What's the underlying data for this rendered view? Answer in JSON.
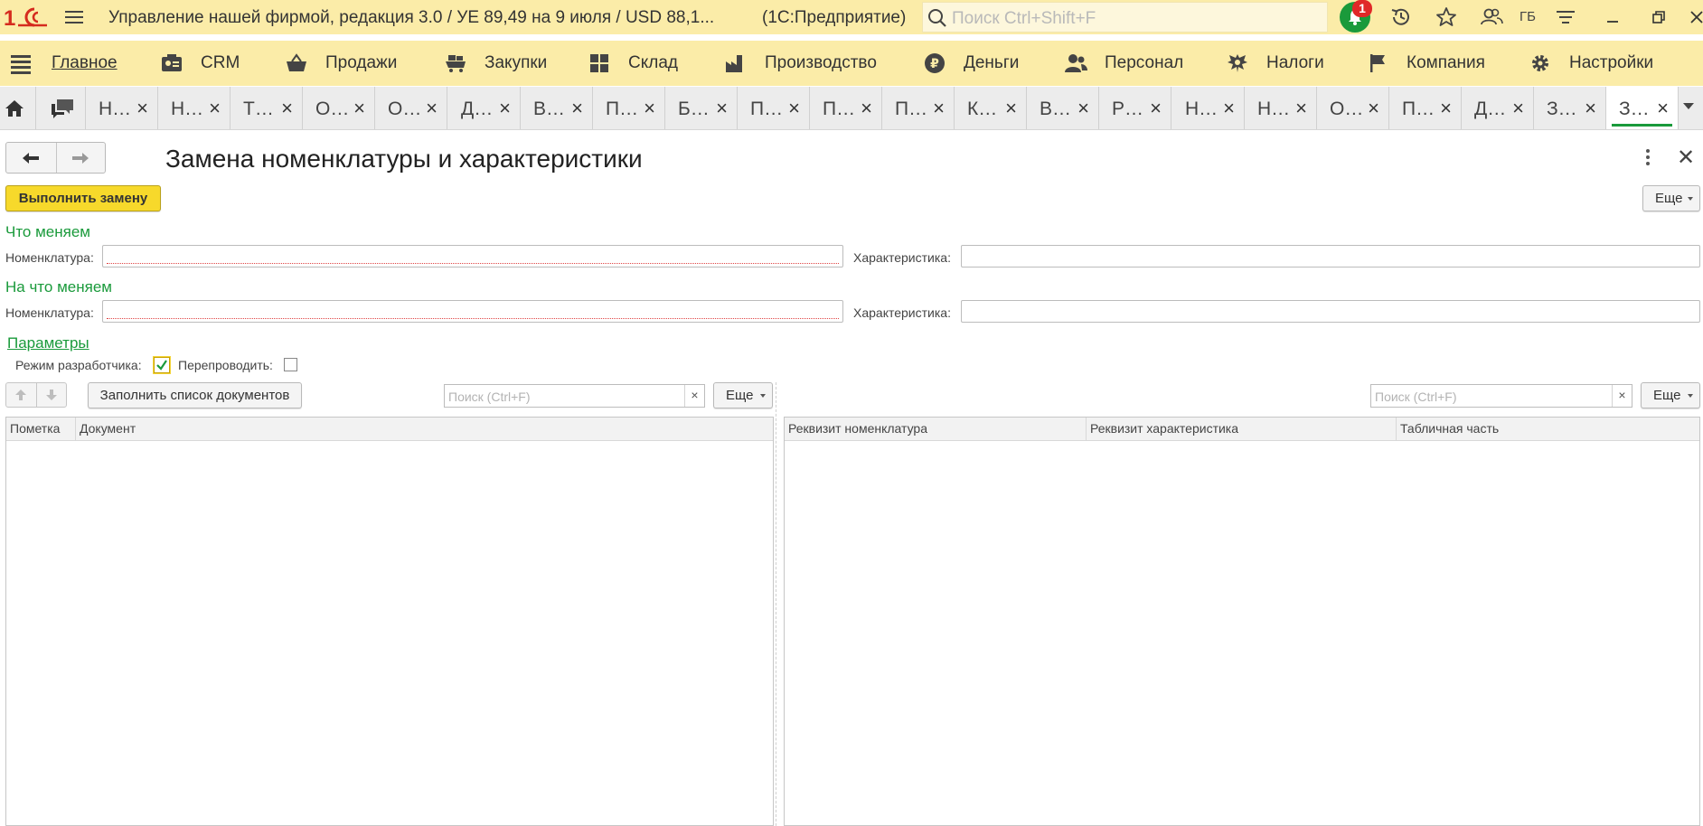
{
  "app": {
    "title": "Управление нашей фирмой, редакция 3.0 / УЕ 89,49 на 9 июля / USD 88,1...",
    "platform": "(1С:Предприятие)",
    "search_placeholder": "Поиск Ctrl+Shift+F",
    "notification_count": "1",
    "user_initials": "ГБ",
    "accent_color": "#1a9a3b",
    "panel_color": "#fbeca8"
  },
  "sections": [
    {
      "label": "Главное",
      "icon": "list-icon"
    },
    {
      "label": "CRM",
      "icon": "contact-card-icon"
    },
    {
      "label": "Продажи",
      "icon": "basket-icon"
    },
    {
      "label": "Закупки",
      "icon": "cart-icon"
    },
    {
      "label": "Склад",
      "icon": "warehouse-grid-icon"
    },
    {
      "label": "Производство",
      "icon": "factory-icon"
    },
    {
      "label": "Деньги",
      "icon": "ruble-coin-icon"
    },
    {
      "label": "Персонал",
      "icon": "people-icon"
    },
    {
      "label": "Налоги",
      "icon": "eagle-emblem-icon"
    },
    {
      "label": "Компания",
      "icon": "flag-icon"
    },
    {
      "label": "Настройки",
      "icon": "gear-icon"
    }
  ],
  "tabs": [
    "Н…",
    "Н…",
    "Т…",
    "О…",
    "О…",
    "Д…",
    "В…",
    "П…",
    "Б…",
    "П…",
    "П…",
    "П…",
    "К…",
    "В…",
    "Р…",
    "Н…",
    "Н…",
    "О…",
    "П…",
    "Д…",
    "З…",
    "З…"
  ],
  "form": {
    "title": "Замена номенклатуры и характеристики",
    "run_button": "Выполнить замену",
    "more_button": "Еще",
    "group_from": "Что меняем",
    "group_to": "На что меняем",
    "nomenclature_label": "Номенклатура:",
    "characteristic_label": "Характеристика:",
    "from": {
      "nomenclature": "",
      "characteristic": ""
    },
    "to": {
      "nomenclature": "",
      "characteristic": ""
    },
    "params_link": "Параметры",
    "dev_mode_label": "Режим разработчика:",
    "dev_mode_checked": true,
    "repost_label": "Перепроводить:",
    "repost_checked": false,
    "fill_button": "Заполнить список документов",
    "search_placeholder": "Поиск (Ctrl+F)",
    "search_clear": "×"
  },
  "documents_table": {
    "columns": [
      "Пометка",
      "Документ"
    ],
    "rows": []
  },
  "attributes_table": {
    "columns": [
      "Реквизит номенклатура",
      "Реквизит характеристика",
      "Табличная часть"
    ],
    "rows": []
  }
}
